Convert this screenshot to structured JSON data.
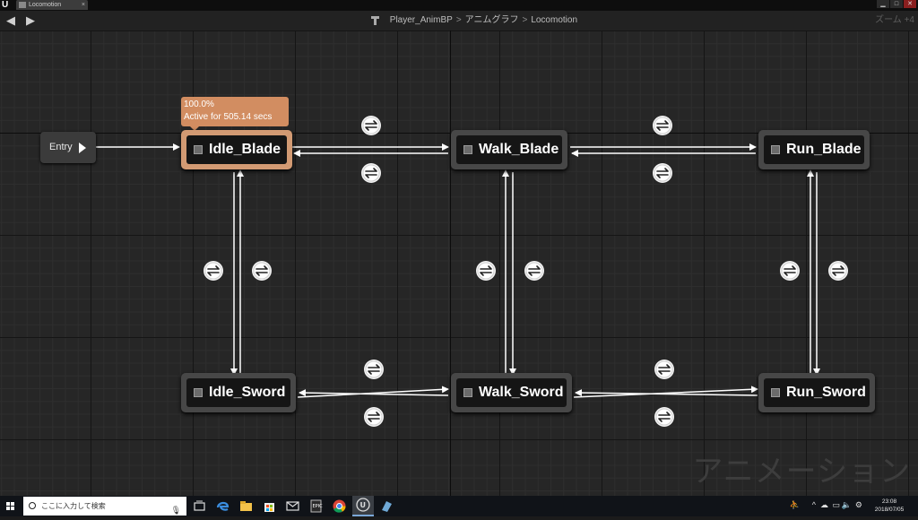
{
  "window": {
    "tab_title": "Locomotion",
    "min": "▁",
    "max": "□",
    "close": "✕"
  },
  "header": {
    "back_glyph": "◀",
    "fwd_glyph": "▶",
    "breadcrumbs": [
      "Player_AnimBP",
      "アニムグラフ",
      "Locomotion"
    ],
    "separator": ">",
    "zoom": "ズーム +4"
  },
  "graph": {
    "entry_label": "Entry",
    "active_tooltip": {
      "percent": "100.0%",
      "text": "Active for 505.14 secs"
    },
    "states": {
      "idle_blade": "Idle_Blade",
      "walk_blade": "Walk_Blade",
      "run_blade": "Run_Blade",
      "idle_sword": "Idle_Sword",
      "walk_sword": "Walk_Sword",
      "run_sword": "Run_Sword"
    },
    "watermark": "アニメーション",
    "colors": {
      "active_state": "#d29a73",
      "tooltip": "#d28d61",
      "node": "#474747",
      "wire": "#ffffff"
    }
  },
  "taskbar": {
    "search_placeholder": "ここに入力して検索",
    "time": "23:08",
    "date": "2018/07/05",
    "icons": [
      "task-view-icon",
      "edge-icon",
      "file-explorer-icon",
      "store-icon",
      "mail-icon",
      "epic-launcher-icon",
      "chrome-icon",
      "unreal-engine-icon",
      "app-icon"
    ]
  }
}
